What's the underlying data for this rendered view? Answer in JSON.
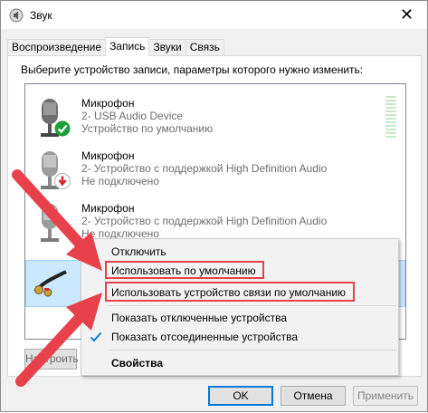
{
  "window": {
    "title": "Звук",
    "close_glyph": "✕"
  },
  "tabs": [
    {
      "label": "Воспроизведение",
      "active": false
    },
    {
      "label": "Запись",
      "active": true
    },
    {
      "label": "Звуки",
      "active": false
    },
    {
      "label": "Связь",
      "active": false
    }
  ],
  "instruction": "Выберите устройство записи, параметры которого нужно изменить:",
  "devices": [
    {
      "name": "Микрофон",
      "line2": "2- USB Audio Device",
      "line3": "Устройство по умолчанию",
      "badge": "green-check-icon"
    },
    {
      "name": "Микрофон",
      "line2": "2- Устройство с поддержкой High Definition Audio",
      "line3": "Не подключено",
      "badge": "red-down-arrow-icon"
    },
    {
      "name": "Микрофон",
      "line2": "2- Устройство с поддержкой High Definition Audio",
      "line3": "Не подключено",
      "badge": "red-down-arrow-icon"
    }
  ],
  "context_menu": {
    "items": [
      {
        "label": "Отключить"
      },
      {
        "label": "Использовать по умолчанию"
      },
      {
        "label": "Использовать устройство связи по умолчанию"
      },
      {
        "label": "Показать отключенные устройства",
        "checked": false
      },
      {
        "label": "Показать отсоединенные устройства",
        "checked": true
      },
      {
        "label": "Свойства",
        "bold": true
      }
    ]
  },
  "panel_buttons": {
    "configure_partial": "Настроить"
  },
  "buttons": {
    "ok": "OK",
    "cancel": "Отмена",
    "apply": "Применить"
  },
  "colors": {
    "annotation_red": "#e8414b",
    "selection": "#cce8ff",
    "check_blue": "#0078d7"
  }
}
